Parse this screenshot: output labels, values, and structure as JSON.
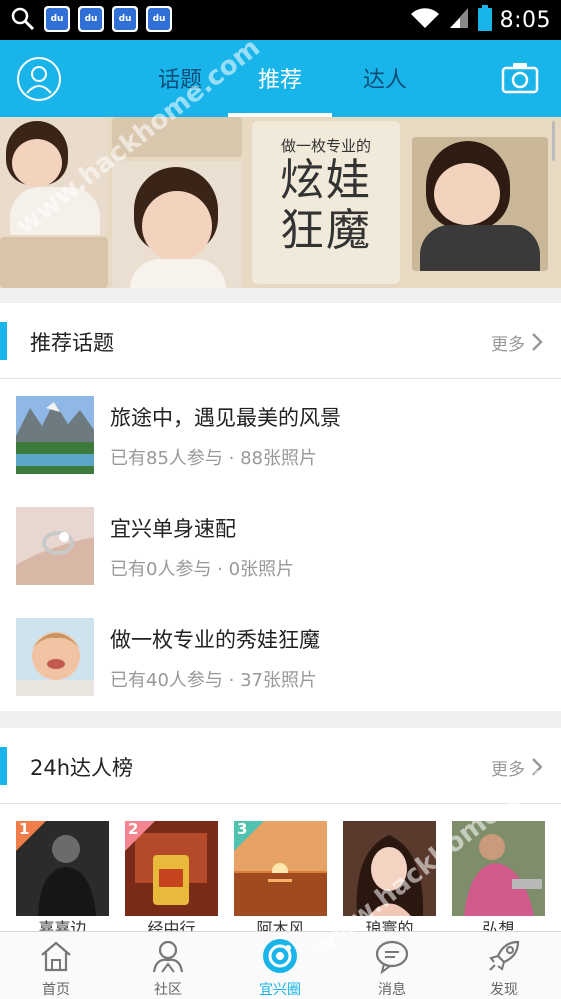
{
  "status_bar": {
    "time": "8:05",
    "notification_icons": [
      "du",
      "du",
      "du",
      "du"
    ]
  },
  "header": {
    "tabs": [
      {
        "label": "话题",
        "active": false
      },
      {
        "label": "推荐",
        "active": true
      },
      {
        "label": "达人",
        "active": false
      }
    ],
    "left_icon": "user-icon",
    "right_icon": "camera-icon"
  },
  "banner": {
    "subtitle": "做一枚专业的",
    "title_line1": "炫娃",
    "title_line2": "狂魔"
  },
  "topics_section": {
    "title": "推荐话题",
    "more": "更多",
    "items": [
      {
        "title": "旅途中，遇见最美的风景",
        "meta": "已有85人参与 · 88张照片"
      },
      {
        "title": "宜兴单身速配",
        "meta": "已有0人参与 · 0张照片"
      },
      {
        "title": "做一枚专业的秀娃狂魔",
        "meta": "已有40人参与 · 37张照片"
      }
    ]
  },
  "experts_section": {
    "title": "24h达人榜",
    "more": "更多",
    "items": [
      {
        "rank": "1",
        "name": "嘉嘉边"
      },
      {
        "rank": "2",
        "name": "经中行"
      },
      {
        "rank": "3",
        "name": "阿木风"
      },
      {
        "rank": "",
        "name": "琅寰的"
      },
      {
        "rank": "",
        "name": "弘想"
      }
    ]
  },
  "watermark": "www.hackhome.com",
  "bottom_nav": [
    {
      "label": "首页",
      "icon": "home-icon",
      "active": false
    },
    {
      "label": "社区",
      "icon": "community-icon",
      "active": false
    },
    {
      "label": "宜兴圈",
      "icon": "circle-icon",
      "active": true
    },
    {
      "label": "消息",
      "icon": "message-icon",
      "active": false
    },
    {
      "label": "发现",
      "icon": "rocket-icon",
      "active": false
    }
  ],
  "colors": {
    "accent": "#19b5ea",
    "rank1": "#f07d4a",
    "rank2": "#f2858f",
    "rank3": "#4fc2b0"
  }
}
